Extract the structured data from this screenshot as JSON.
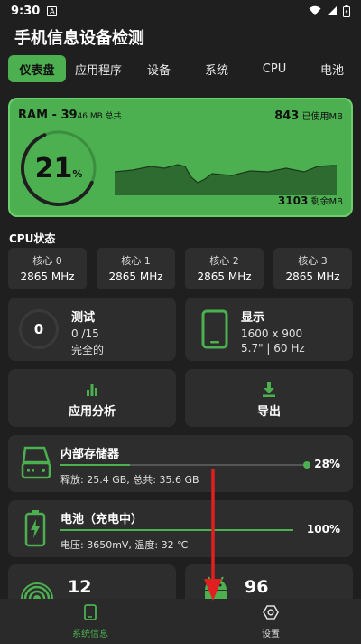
{
  "status": {
    "time": "9:30",
    "a_icon": "A"
  },
  "app": {
    "title": "手机信息设备检测"
  },
  "tabs": [
    {
      "label": "仪表盘"
    },
    {
      "label": "应用程序"
    },
    {
      "label": "设备"
    },
    {
      "label": "系统"
    },
    {
      "label": "CPU"
    },
    {
      "label": "电池"
    }
  ],
  "ram": {
    "label": "RAM - 39",
    "total_small": "46 MB 总共",
    "used_value": "843",
    "used_suffix": " 已使用MB",
    "free_value": "3103",
    "free_suffix": " 剩余MB",
    "percent": "21",
    "percent_sign": "%",
    "usage_fraction": 0.21
  },
  "cpu": {
    "section_label": "CPU状态",
    "cores": [
      {
        "name": "核心 0",
        "freq": "2865 MHz"
      },
      {
        "name": "核心 1",
        "freq": "2865 MHz"
      },
      {
        "name": "核心 2",
        "freq": "2865 MHz"
      },
      {
        "name": "核心 3",
        "freq": "2865 MHz"
      }
    ]
  },
  "test": {
    "score": "0",
    "title": "测试",
    "progress": "0 /15",
    "status": "完全的"
  },
  "display": {
    "title": "显示",
    "resolution": "1600 x 900",
    "details": "5.7\" | 60 Hz"
  },
  "actions": {
    "analysis": "应用分析",
    "export": "导出"
  },
  "storage": {
    "title": "内部存储器",
    "details": "释放: 25.4 GB, 总共: 35.6 GB",
    "percent": "28%",
    "fraction": 0.28
  },
  "battery": {
    "title": "电池（充电中）",
    "details": "电压: 3650mV, 温度: 32 ℃",
    "percent": "100%",
    "fraction": 1.0
  },
  "bottom_cards": {
    "left_value": "12",
    "right_value": "96"
  },
  "nav": {
    "system_info": "系统信息",
    "settings": "设置"
  },
  "colors": {
    "accent": "#4caf50",
    "background": "#1f1f1f",
    "card": "#2d2d2d",
    "annotation_arrow": "#e02020"
  }
}
